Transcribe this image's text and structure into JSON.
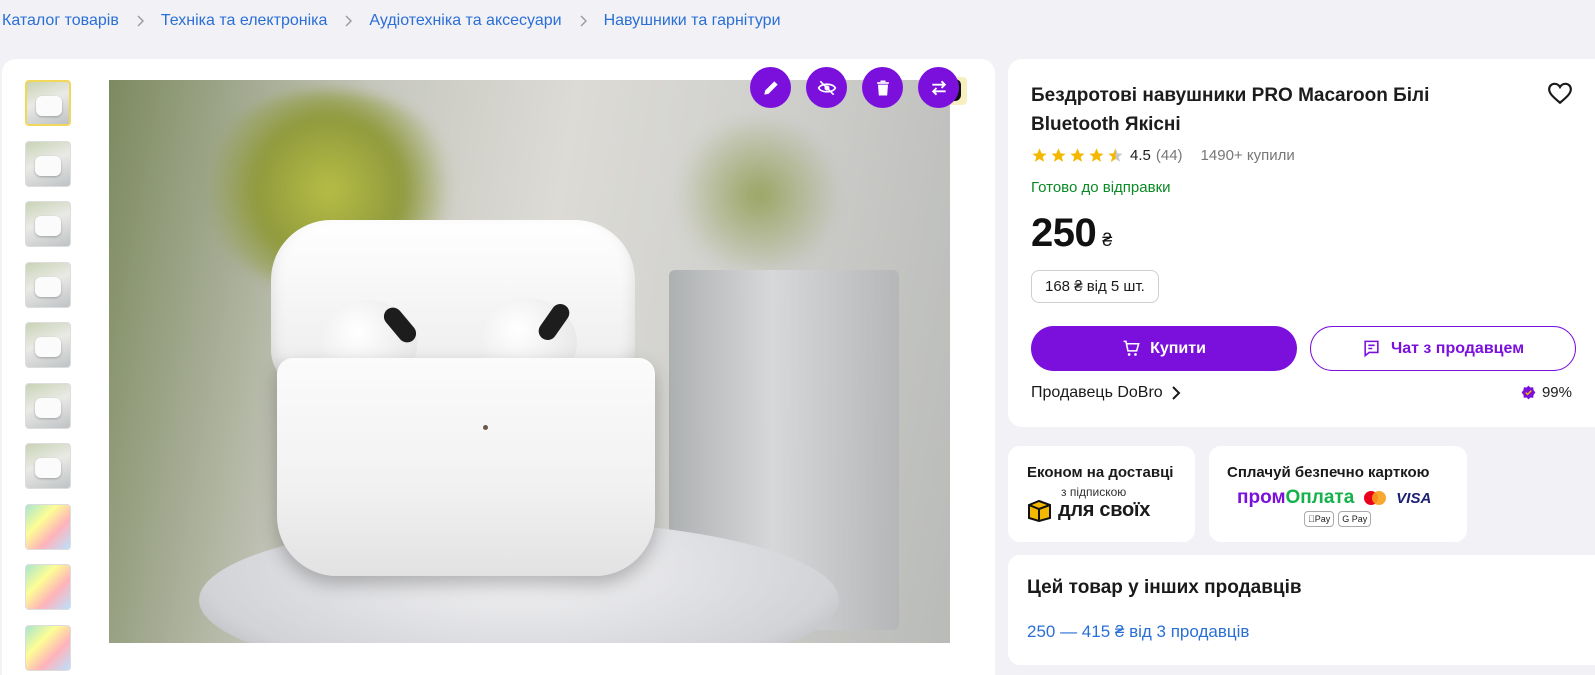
{
  "breadcrumbs": [
    {
      "label": "Каталог товарів"
    },
    {
      "label": "Техніка та електроніка"
    },
    {
      "label": "Аудіотехніка та аксесуари"
    },
    {
      "label": "Навушники та гарнітури"
    }
  ],
  "gallery": {
    "thumbnails_count": 10,
    "active_thumbnail": 1,
    "tools": [
      "edit-icon",
      "hide-icon",
      "delete-icon",
      "swap-icon"
    ]
  },
  "product": {
    "title": "Бездротові навушники PRO Macaroon Білі Bluetooth Якісні",
    "rating": "4.5",
    "rating_value": 4.5,
    "reviews": "(44)",
    "bought": "1490+ купили",
    "availability": "Готово до відправки",
    "price": "250",
    "currency": "₴",
    "wholesale": "168 ₴ від 5 шт.",
    "buy_label": "Купити",
    "chat_label": "Чат з продавцем",
    "seller_label": "Продавець DoBro",
    "seller_score": "99%"
  },
  "promo_delivery": {
    "title": "Економ на доставці",
    "subtitle": "з підпискою",
    "brand": "для своїх"
  },
  "promo_payment": {
    "title": "Сплачуй безпечно карткою",
    "prom_a": "пром",
    "prom_b": "Оплата",
    "visa": "VISA",
    "apple_pay": "Pay",
    "google_pay": "G Pay"
  },
  "other_sellers": {
    "title": "Цей товар у інших продавців",
    "link": "250 — 415 ₴ від 3 продавців"
  },
  "colors": {
    "accent": "#7b10dd",
    "link": "#2a6fd6",
    "success": "#0a8a25",
    "star": "#f5b800"
  }
}
